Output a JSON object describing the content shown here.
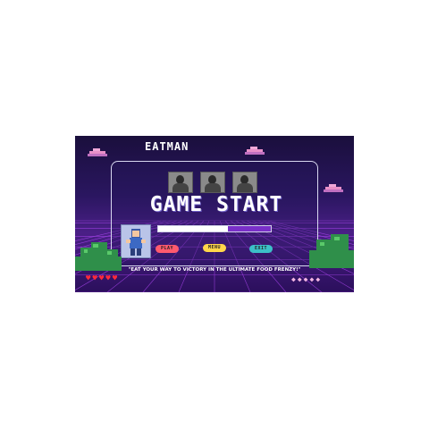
{
  "game": {
    "title": "EATMAN",
    "headline": "GAME START",
    "tagline": "\"EAT YOUR WAY TO VICTORY IN THE ULTIMATE FOOD FRENZY!\"",
    "loading_progress": 0.38,
    "buttons": {
      "play": "PLAY",
      "menu": "MENU",
      "exit": "EXIT"
    },
    "lives_count": 5,
    "gems_count": 5,
    "colors": {
      "play": "#ff5a6e",
      "menu": "#ffd64a",
      "exit": "#3cc0c8",
      "heart": "#ff2a3a",
      "gem": "#f4b6e4",
      "progress_fill": "#7a2fc8"
    },
    "icons": {
      "heart": "♥",
      "gem": "◆"
    }
  }
}
